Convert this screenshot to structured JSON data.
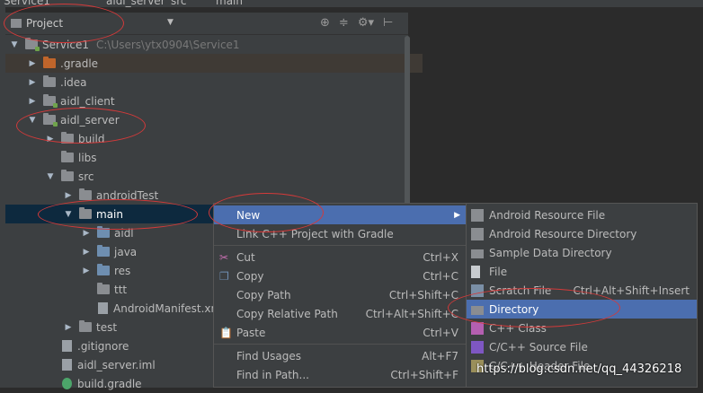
{
  "top_strip": {
    "items": [
      "Service1",
      "aidl_server",
      "src",
      "main"
    ]
  },
  "project_panel": {
    "view_selector": "Project",
    "header_icons": [
      "target-icon",
      "collapse-icon",
      "gear-icon",
      "hide-icon"
    ]
  },
  "tree": [
    {
      "label": "Service1",
      "path": "C:\\Users\\ytx0904\\Service1",
      "arrow": "▼",
      "type": "module",
      "indent": 0
    },
    {
      "label": ".gradle",
      "arrow": "▶",
      "type": "folder-orange",
      "indent": 1
    },
    {
      "label": ".idea",
      "arrow": "▶",
      "type": "folder",
      "indent": 1
    },
    {
      "label": "aidl_client",
      "arrow": "▶",
      "type": "module",
      "indent": 1
    },
    {
      "label": "aidl_server",
      "arrow": "▼",
      "type": "module",
      "indent": 1
    },
    {
      "label": "build",
      "arrow": "▶",
      "type": "folder",
      "indent": 2
    },
    {
      "label": "libs",
      "arrow": "",
      "type": "folder",
      "indent": 2
    },
    {
      "label": "src",
      "arrow": "▼",
      "type": "folder",
      "indent": 2
    },
    {
      "label": "androidTest",
      "arrow": "▶",
      "type": "folder",
      "indent": 3
    },
    {
      "label": "main",
      "arrow": "▼",
      "type": "folder",
      "indent": 3
    },
    {
      "label": "aidl",
      "arrow": "▶",
      "type": "folder-blue",
      "indent": 4
    },
    {
      "label": "java",
      "arrow": "▶",
      "type": "folder-blue",
      "indent": 4
    },
    {
      "label": "res",
      "arrow": "▶",
      "type": "folder-blue",
      "indent": 4
    },
    {
      "label": "ttt",
      "arrow": "",
      "type": "folder",
      "indent": 4
    },
    {
      "label": "AndroidManifest.xm",
      "arrow": "",
      "type": "file",
      "indent": 4
    },
    {
      "label": "test",
      "arrow": "▶",
      "type": "folder",
      "indent": 3
    },
    {
      "label": ".gitignore",
      "arrow": "",
      "type": "file",
      "indent": 2
    },
    {
      "label": "aidl_server.iml",
      "arrow": "",
      "type": "file",
      "indent": 2
    },
    {
      "label": "build.gradle",
      "arrow": "",
      "type": "file-gradle",
      "indent": 2
    }
  ],
  "context_menu": {
    "items": [
      {
        "label": "New",
        "shortcut": "",
        "submenu": true,
        "icon": "",
        "highlight": true
      },
      {
        "label": "Link C++ Project with Gradle",
        "shortcut": "",
        "icon": "",
        "sep_after": true
      },
      {
        "label": "Cut",
        "shortcut": "Ctrl+X",
        "icon": "scissors-icon"
      },
      {
        "label": "Copy",
        "shortcut": "Ctrl+C",
        "icon": "copy-icon"
      },
      {
        "label": "Copy Path",
        "shortcut": "Ctrl+Shift+C",
        "icon": ""
      },
      {
        "label": "Copy Relative Path",
        "shortcut": "Ctrl+Alt+Shift+C",
        "icon": ""
      },
      {
        "label": "Paste",
        "shortcut": "Ctrl+V",
        "icon": "paste-icon",
        "sep_after": true
      },
      {
        "label": "Find Usages",
        "shortcut": "Alt+F7",
        "icon": ""
      },
      {
        "label": "Find in Path...",
        "shortcut": "Ctrl+Shift+F",
        "icon": ""
      }
    ]
  },
  "submenu": {
    "items": [
      {
        "label": "Android Resource File",
        "shortcut": "",
        "icon": "android-resource-file-icon"
      },
      {
        "label": "Android Resource Directory",
        "shortcut": "",
        "icon": "android-resource-dir-icon"
      },
      {
        "label": "Sample Data Directory",
        "shortcut": "",
        "icon": "folder-icon"
      },
      {
        "label": "File",
        "shortcut": "",
        "icon": "file-icon"
      },
      {
        "label": "Scratch File",
        "shortcut": "Ctrl+Alt+Shift+Insert",
        "icon": "scratch-file-icon"
      },
      {
        "label": "Directory",
        "shortcut": "",
        "icon": "folder-icon",
        "highlight": true
      },
      {
        "label": "C++ Class",
        "shortcut": "",
        "icon": "cpp-class-icon"
      },
      {
        "label": "C/C++ Source File",
        "shortcut": "",
        "icon": "cpp-source-icon"
      },
      {
        "label": "C/C++ Header File",
        "shortcut": "",
        "icon": "cpp-header-icon"
      }
    ]
  },
  "watermark": "https://blog.csdn.net/qq_44326218",
  "colors": {
    "highlight": "#4b6eaf",
    "selection": "#0d293e",
    "annotation": "#d33a3a"
  }
}
